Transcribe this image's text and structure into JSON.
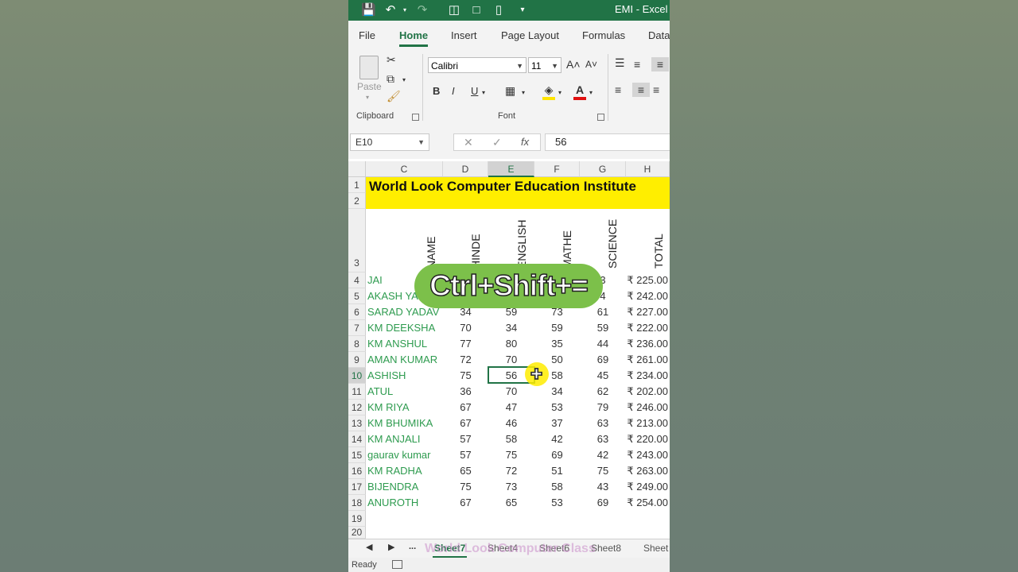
{
  "window": {
    "title": "EMI - Excel"
  },
  "ribbon_tabs": [
    "File",
    "Home",
    "Insert",
    "Page Layout",
    "Formulas",
    "Data"
  ],
  "ribbon": {
    "paste_label": "Paste",
    "clipboard_label": "Clipboard",
    "font_label": "Font",
    "font_name": "Calibri",
    "font_size": "11",
    "grow_font": "A˄",
    "shrink_font": "A˅",
    "bold": "B",
    "italic": "I",
    "underline": "U"
  },
  "formula_bar": {
    "name_box": "E10",
    "fx": "fx",
    "value": "56"
  },
  "columns": [
    "C",
    "D",
    "E",
    "F",
    "G",
    "H"
  ],
  "rows": [
    "1",
    "2",
    "3",
    "4",
    "5",
    "6",
    "7",
    "8",
    "9",
    "10",
    "11",
    "12",
    "13",
    "14",
    "15",
    "16",
    "17",
    "18",
    "19",
    "20"
  ],
  "sheet_title": "World Look Computer Education Institute",
  "headers": [
    "NAME",
    "HINDE",
    "ENGLISH",
    "MATHE",
    "SCIENCE",
    "TOTAL"
  ],
  "table": [
    {
      "name": "JAI",
      "hinde": "",
      "english": "",
      "mathe": "",
      "science": "3",
      "total": "₹ 225.00"
    },
    {
      "name": "AKASH YA",
      "hinde": "",
      "english": "",
      "mathe": "",
      "science": "4",
      "total": "₹ 242.00"
    },
    {
      "name": "SARAD YADAV",
      "hinde": "34",
      "english": "59",
      "mathe": "73",
      "science": "61",
      "total": "₹ 227.00"
    },
    {
      "name": "KM DEEKSHA",
      "hinde": "70",
      "english": "34",
      "mathe": "59",
      "science": "59",
      "total": "₹ 222.00"
    },
    {
      "name": "KM ANSHUL",
      "hinde": "77",
      "english": "80",
      "mathe": "35",
      "science": "44",
      "total": "₹ 236.00"
    },
    {
      "name": "AMAN KUMAR",
      "hinde": "72",
      "english": "70",
      "mathe": "50",
      "science": "69",
      "total": "₹ 261.00"
    },
    {
      "name": "ASHISH",
      "hinde": "75",
      "english": "56",
      "mathe": "58",
      "science": "45",
      "total": "₹ 234.00"
    },
    {
      "name": "ATUL",
      "hinde": "36",
      "english": "70",
      "mathe": "34",
      "science": "62",
      "total": "₹ 202.00"
    },
    {
      "name": "KM RIYA",
      "hinde": "67",
      "english": "47",
      "mathe": "53",
      "science": "79",
      "total": "₹ 246.00"
    },
    {
      "name": "KM BHUMIKA",
      "hinde": "67",
      "english": "46",
      "mathe": "37",
      "science": "63",
      "total": "₹ 213.00"
    },
    {
      "name": "KM ANJALI",
      "hinde": "57",
      "english": "58",
      "mathe": "42",
      "science": "63",
      "total": "₹ 220.00"
    },
    {
      "name": "gaurav kumar",
      "hinde": "57",
      "english": "75",
      "mathe": "69",
      "science": "42",
      "total": "₹ 243.00"
    },
    {
      "name": "KM RADHA",
      "hinde": "65",
      "english": "72",
      "mathe": "51",
      "science": "75",
      "total": "₹ 263.00"
    },
    {
      "name": "BIJENDRA",
      "hinde": "75",
      "english": "73",
      "mathe": "58",
      "science": "43",
      "total": "₹ 249.00"
    },
    {
      "name": "ANUROTH",
      "hinde": "67",
      "english": "65",
      "mathe": "53",
      "science": "69",
      "total": "₹ 254.00"
    }
  ],
  "sheets": [
    "Sheet7",
    "Sheet4",
    "Sheet6",
    "Sheet8",
    "Sheet"
  ],
  "sheet_nav_more": "...",
  "status": "Ready",
  "overlay_text": "Ctrl+Shift+=",
  "watermark": "World Look Computer Class",
  "colors": {
    "excel_green": "#217346",
    "title_fill": "#ffee00",
    "name_text": "#2e9b4f",
    "overlay_bg": "#7cc04a"
  }
}
